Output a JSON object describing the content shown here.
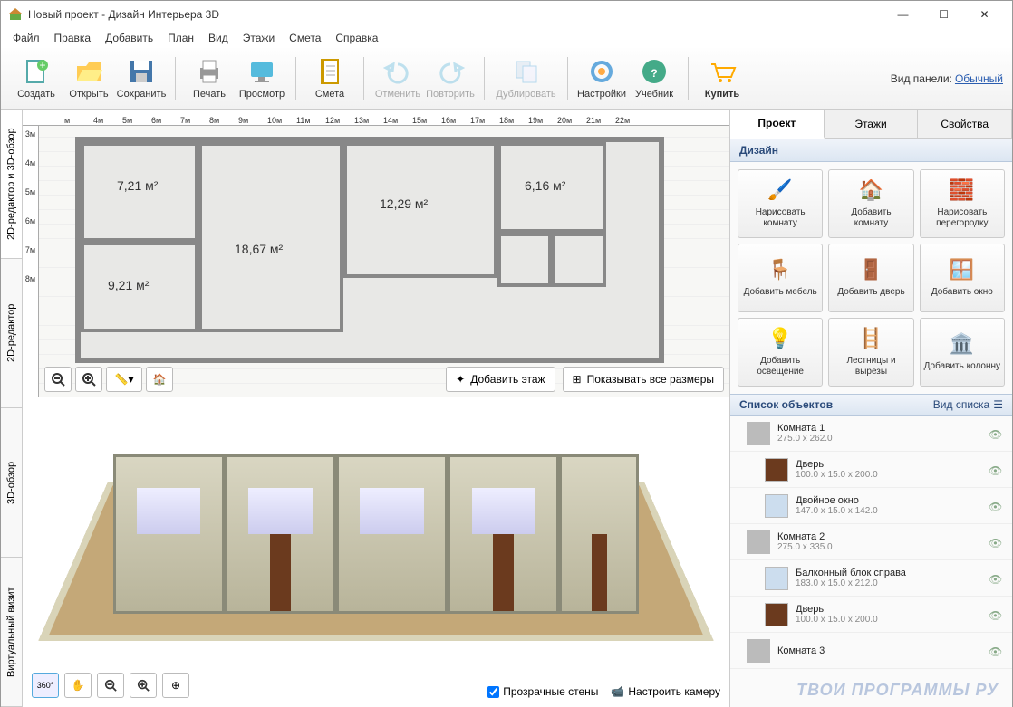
{
  "window": {
    "title": "Новый проект - Дизайн Интерьера 3D"
  },
  "menu": [
    "Файл",
    "Правка",
    "Добавить",
    "План",
    "Вид",
    "Этажи",
    "Смета",
    "Справка"
  ],
  "toolbar": {
    "groups": [
      [
        "Создать",
        "Открыть",
        "Сохранить"
      ],
      [
        "Печать",
        "Просмотр"
      ],
      [
        "Смета"
      ],
      [
        "Отменить",
        "Повторить"
      ],
      [
        "Дублировать"
      ],
      [
        "Настройки",
        "Учебник"
      ],
      [
        "Купить"
      ]
    ],
    "panel_label": "Вид панели:",
    "panel_value": "Обычный"
  },
  "ruler_h": [
    "м",
    "4м",
    "5м",
    "6м",
    "7м",
    "8м",
    "9м",
    "10м",
    "11м",
    "12м",
    "13м",
    "14м",
    "15м",
    "16м",
    "17м",
    "18м",
    "19м",
    "20м",
    "21м",
    "22м"
  ],
  "ruler_v": [
    "3м",
    "4м",
    "5м",
    "6м",
    "7м",
    "8м"
  ],
  "rooms": {
    "r1": "7,21 м²",
    "r2": "18,67 м²",
    "r3": "12,29 м²",
    "r4": "6,16 м²",
    "r5": "9,21 м²"
  },
  "plan_buttons": {
    "add_floor": "Добавить этаж",
    "show_dims": "Показывать все размеры"
  },
  "left_tabs": [
    "2D-редактор и 3D-обзор",
    "2D-редактор",
    "3D-обзор",
    "Виртуальный визит"
  ],
  "view3d": {
    "transparent": "Прозрачные стены",
    "camera": "Настроить камеру"
  },
  "right_tabs": [
    "Проект",
    "Этажи",
    "Свойства"
  ],
  "design_header": "Дизайн",
  "design_buttons": [
    "Нарисовать комнату",
    "Добавить комнату",
    "Нарисовать перегородку",
    "Добавить мебель",
    "Добавить дверь",
    "Добавить окно",
    "Добавить освещение",
    "Лестницы и вырезы",
    "Добавить колонну"
  ],
  "objects_header": "Список объектов",
  "list_mode": "Вид списка",
  "objects": [
    {
      "name": "Комната 1",
      "dim": "275.0 x 262.0",
      "icon": "#bbb"
    },
    {
      "name": "Дверь",
      "dim": "100.0 x 15.0 x 200.0",
      "icon": "#6b3a1e"
    },
    {
      "name": "Двойное окно",
      "dim": "147.0 x 15.0 x 142.0",
      "icon": "#cde"
    },
    {
      "name": "Комната 2",
      "dim": "275.0 x 335.0",
      "icon": "#bbb"
    },
    {
      "name": "Балконный блок справа",
      "dim": "183.0 x 15.0 x 212.0",
      "icon": "#cde"
    },
    {
      "name": "Дверь",
      "dim": "100.0 x 15.0 x 200.0",
      "icon": "#6b3a1e"
    },
    {
      "name": "Комната 3",
      "dim": "",
      "icon": "#bbb"
    }
  ],
  "watermark": "ТВОИ ПРОГРАММЫ РУ"
}
